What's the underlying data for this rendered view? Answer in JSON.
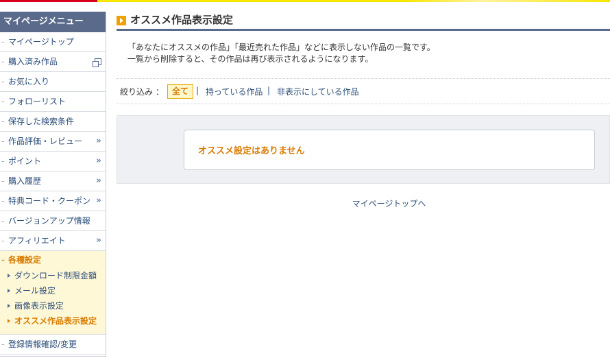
{
  "sidebar": {
    "heading": "マイページメニュー",
    "items": [
      {
        "label": "マイページトップ"
      },
      {
        "label": "購入済み作品"
      },
      {
        "label": "お気に入り"
      },
      {
        "label": "フォローリスト"
      },
      {
        "label": "保存した検索条件"
      },
      {
        "label": "作品評価・レビュー"
      },
      {
        "label": "ポイント"
      },
      {
        "label": "購入履歴"
      },
      {
        "label": "特典コード・クーポン"
      },
      {
        "label": "バージョンアップ情報"
      },
      {
        "label": "アフィリエイト"
      }
    ],
    "settings": {
      "heading": "各種設定",
      "items": [
        {
          "label": "ダウンロード制限金額"
        },
        {
          "label": "メール設定"
        },
        {
          "label": "画像表示設定"
        },
        {
          "label": "オススメ作品表示設定"
        }
      ]
    },
    "last_item": {
      "label": "登録情報確認/変更"
    },
    "chevron": "»",
    "dash": "-"
  },
  "main": {
    "title": "オススメ作品表示設定",
    "desc_line1": "「あなたにオススメの作品」「最近売れた作品」などに表示しない作品の一覧です。",
    "desc_line2": "一覧から削除すると、その作品は再び表示されるようになります。",
    "filter": {
      "label": "絞り込み ：",
      "options": [
        {
          "label": "全て",
          "selected": true
        },
        {
          "label": "持っている作品"
        },
        {
          "label": "非表示にしている作品"
        }
      ],
      "separator": "|"
    },
    "notice": "オススメ設定はありません",
    "back_link": "マイページトップへ"
  },
  "colors": {
    "accent": "#d97a00",
    "nav_header": "#5a6a8a",
    "link": "#2a4d7a",
    "settings_bg": "#fff8d6"
  }
}
